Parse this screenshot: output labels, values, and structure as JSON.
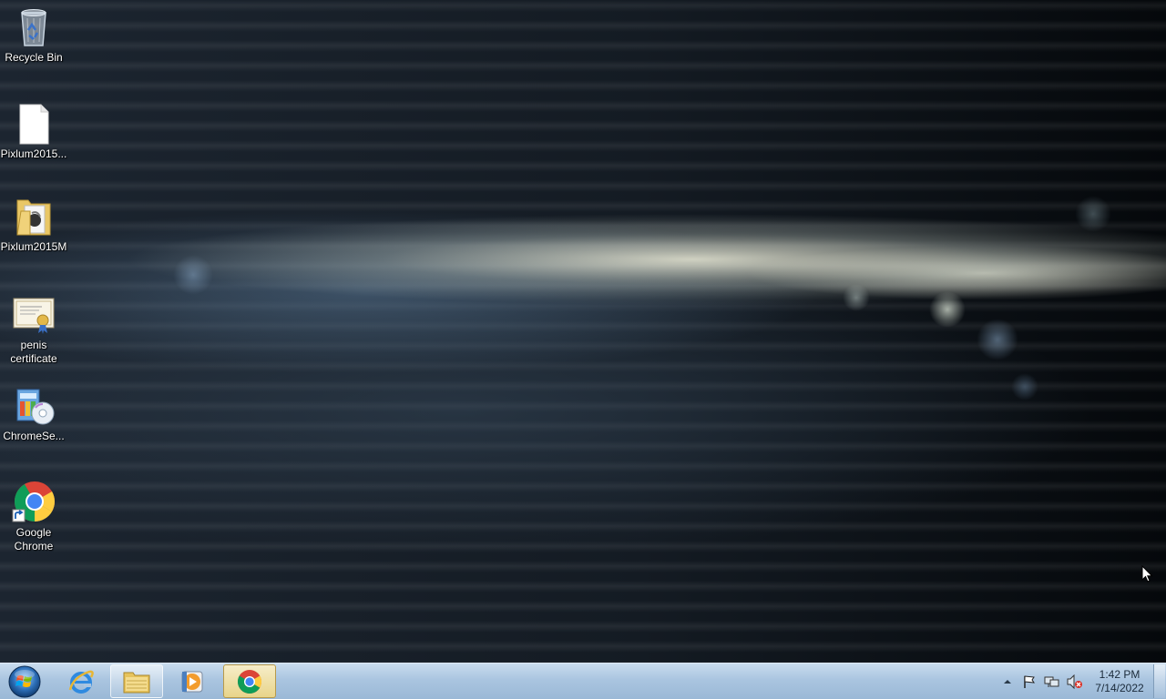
{
  "desktop": {
    "icons": [
      {
        "label": "Recycle Bin",
        "icon": "recycle-bin-icon"
      },
      {
        "label": "Pixlum2015...",
        "icon": "blank-file-icon"
      },
      {
        "label": "Pixlum2015M",
        "icon": "folder-icon"
      },
      {
        "label": "penis certificate",
        "icon": "certificate-icon"
      },
      {
        "label": "ChromeSe...",
        "icon": "installer-icon"
      },
      {
        "label": "Google Chrome",
        "icon": "chrome-shortcut-icon"
      }
    ]
  },
  "taskbar": {
    "start": {
      "icon": "windows-orb-icon"
    },
    "buttons": [
      {
        "name": "internet-explorer",
        "icon": "internet-explorer-icon",
        "state": "pinned"
      },
      {
        "name": "windows-explorer",
        "icon": "file-explorer-icon",
        "state": "open"
      },
      {
        "name": "windows-media-player",
        "icon": "media-player-icon",
        "state": "pinned"
      },
      {
        "name": "google-chrome",
        "icon": "chrome-icon",
        "state": "active"
      }
    ],
    "tray": {
      "icons": [
        "show-hidden-icons-arrow",
        "action-center-flag-icon",
        "network-icon",
        "volume-muted-icon"
      ],
      "time": "1:42 PM",
      "date": "7/14/2022"
    }
  },
  "colors": {
    "taskbar": "#aac5e0",
    "desktop_bg": "#141b23",
    "label_text": "#ffffff"
  }
}
